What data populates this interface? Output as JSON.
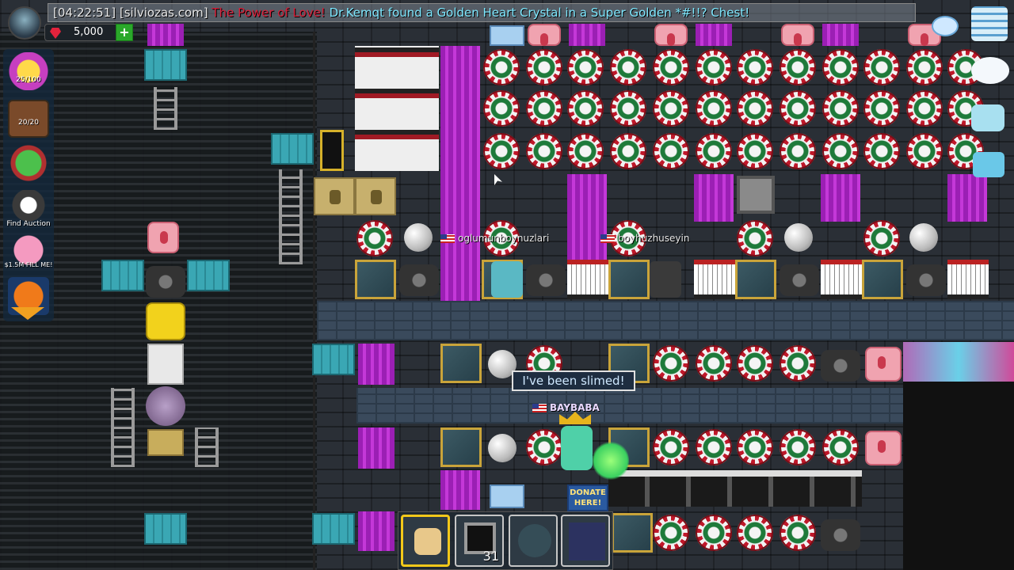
{
  "chat": {
    "timestamp": "[04:22:51]",
    "server": "[silviozas.com]",
    "event": "The Power of Love!",
    "message": "Dr.Kemqt found a Golden Heart Crystal in a Super Golden *#!!? Chest!"
  },
  "hud": {
    "gems": "5,000",
    "add_gems": "+",
    "energy": "25/100",
    "backpack": "20/20",
    "find_auction": "Find Auction",
    "piggy": "$1.5M FILL ME!"
  },
  "players": {
    "p1": "oglumunboynuzlari",
    "p2": "boyhuzhuseyin",
    "self": "BAYBABA"
  },
  "speech": "I've been slimed!",
  "donate_sign": "DONATE HERE!",
  "inventory": {
    "slots": [
      {
        "item": "fist-icon",
        "count": ""
      },
      {
        "item": "wrench-block-icon",
        "count": "31"
      },
      {
        "item": "roulette-icon",
        "count": ""
      },
      {
        "item": "glass-pane-icon",
        "count": ""
      }
    ]
  },
  "colors": {
    "event_text": "#d8203a",
    "chat_text": "#7ee8ff",
    "purple": "#b02ac8",
    "gold_frame": "#c9a43a"
  }
}
